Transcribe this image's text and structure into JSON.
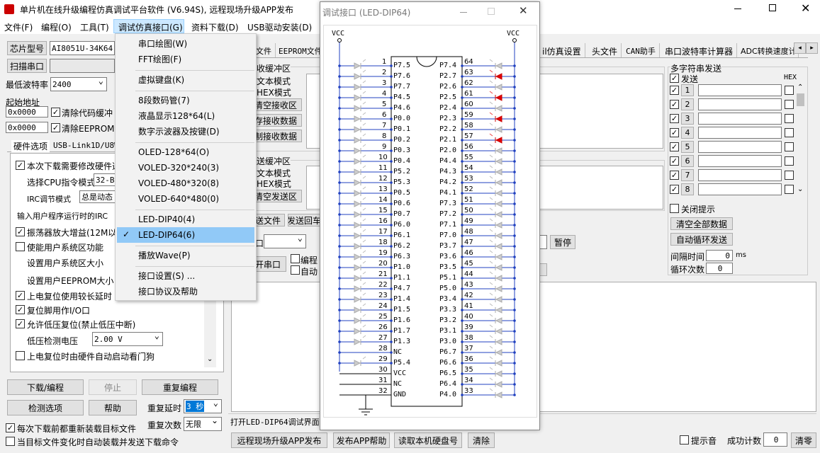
{
  "title": "单片机在线升级编程仿真调试平台软件 (V6.94S), 远程现场升级APP发布",
  "menubar": [
    "文件(F)",
    "编程(O)",
    "工具(T)",
    "调试仿真接口(G)",
    "资料下载(D)",
    "USB驱动安装(D)"
  ],
  "left": {
    "chip_btn": "芯片型号",
    "chip_value": "AI8051U-34K64",
    "scan_btn": "扫描串口",
    "baud_label": "最低波特率",
    "baud_value": "2400",
    "start_addr_label": "起始地址",
    "addr1": "0x0000",
    "clear_code": "清除代码缓冲",
    "addr2": "0x0000",
    "clear_eeprom": "清除EEPROM缓",
    "tab_hw": "硬件选项",
    "tab_usb": "USB-Link1D/U8W",
    "options": {
      "o1": "本次下载需要修改硬件选",
      "cpu_label": "选择CPU指令模式",
      "cpu_value": "32-B",
      "irc_label": "IRC调节模式",
      "irc_value": "总是动态",
      "freq_label": "输入用户程序运行时的IRC",
      "o2": "振荡器放大增益(12M以",
      "o3": "使能用户系统区功能",
      "sys_size": "设置用户系统区大小",
      "eeprom_size": "设置用户EEPROM大小",
      "o4": "上电复位使用较长延时",
      "o5": "复位脚用作I/O口",
      "o6": "允许低压复位(禁止低压中断)",
      "lv_label": "低压检测电压",
      "lv_value": "2.00 V",
      "o7": "上电复位时由硬件自动启动看门狗"
    },
    "download_btn": "下载/编程",
    "stop_btn": "停止",
    "reprog_btn": "重复编程",
    "check_btn": "检测选项",
    "help_btn": "帮助",
    "delay_label": "重复延时",
    "delay_value": "3 秒",
    "count_label": "重复次数",
    "count_value": "无限",
    "reload_each": "每次下载前都重新装载目标文件",
    "auto_reload": "当目标文件变化时自动装载并发送下载命令"
  },
  "menu": {
    "items": [
      "串口绘图(W)",
      "FFT绘图(F)",
      "虚拟键盘(K)",
      "8段数码管(7)",
      "液晶显示128*64(L)",
      "数字示波器及按键(D)",
      "OLED-128*64(O)",
      "VOLED-320*240(3)",
      "VOLED-480*320(8)",
      "VOLED-640*480(0)",
      "LED-DIP40(4)",
      "LED-DIP64(6)",
      "播放Wave(P)",
      "接口设置(S) ...",
      "接口协议及帮助"
    ],
    "checkmark": "✓"
  },
  "dialog": {
    "title": "调试接口 (LED-DIP64)",
    "vcc": "VCC",
    "ncs": "NC",
    "gnd": "GND",
    "left_pins": [
      "P7.5",
      "P7.6",
      "P7.7",
      "P4.5",
      "P4.6",
      "P0.0",
      "P0.1",
      "P0.2",
      "P0.3",
      "P0.4",
      "P5.2",
      "P5.3",
      "P0.5",
      "P0.6",
      "P0.7",
      "P6.0",
      "P6.1",
      "P6.2",
      "P6.3",
      "P1.0",
      "P1.1",
      "P4.7",
      "P1.4",
      "P1.5",
      "P1.6",
      "P1.7",
      "P1.3",
      "NC",
      "P5.4",
      "VCC",
      "NC",
      "GND"
    ],
    "right_pins": [
      "P7.4",
      "P2.7",
      "P2.6",
      "P2.5",
      "P2.4",
      "P2.3",
      "P2.2",
      "P2.1",
      "P2.0",
      "P4.4",
      "P4.3",
      "P4.2",
      "P4.1",
      "P7.3",
      "P7.2",
      "P7.1",
      "P7.0",
      "P3.7",
      "P3.6",
      "P3.5",
      "P5.1",
      "P5.0",
      "P3.4",
      "P3.3",
      "P3.2",
      "P3.1",
      "P3.0",
      "P6.7",
      "P6.6",
      "P6.5",
      "P6.4",
      "P4.0"
    ],
    "lit_right_pins": [
      "63",
      "61",
      "59",
      "57"
    ]
  },
  "middle_tabs": [
    "文件",
    "EEPROM文件"
  ],
  "right_tabs": [
    "il仿真设置",
    "头文件",
    "CAN助手",
    "串口波特率计算器",
    "ADC转换速度计"
  ],
  "recv": {
    "title": "收缓冲区",
    "text_mode": "文本模式",
    "hex_mode": "HEX模式",
    "clear": "清空接收区",
    "save": "存接收数据",
    "copy": "制接收数据"
  },
  "send": {
    "title": "送缓冲区",
    "text_mode": "文本模式",
    "hex_mode": "HEX模式",
    "clear": "清空发送区",
    "send_file": "送文件",
    "send_back": "发送回车"
  },
  "serial": {
    "port_label": "口",
    "open": "开串口",
    "prog_label": "编程",
    "auto_label": "自动",
    "pause": "暂停"
  },
  "multi": {
    "title": "多字符串发送",
    "send": "发送",
    "hex": "HEX",
    "rows": [
      "1",
      "2",
      "3",
      "4",
      "5",
      "6",
      "7",
      "8"
    ],
    "close_hint": "关闭提示",
    "clear_all": "清空全部数据",
    "auto_loop": "自动循环发送",
    "interval_label": "间隔时间",
    "interval_value": "0",
    "interval_unit": "ms",
    "loop_label": "循环次数",
    "loop_value": "0"
  },
  "status_text": "打开LED-DIP64调试界面",
  "bottom": {
    "publish": "远程现场升级APP发布",
    "publish_help": "发布APP帮助",
    "read_disk": "读取本机硬盘号",
    "clear": "清除",
    "beep": "提示音",
    "success_label": "成功计数",
    "success_value": "0",
    "clear2": "清零"
  }
}
